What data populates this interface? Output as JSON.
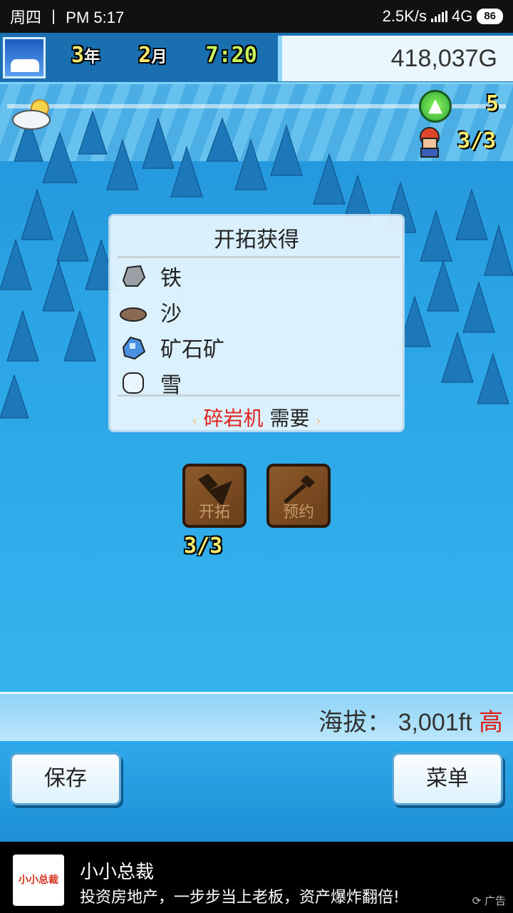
{
  "status_bar": {
    "day": "周四",
    "separator": "丨",
    "ampm": "PM",
    "time": "5:17",
    "net_speed": "2.5K/s",
    "network": "4G",
    "battery": "86"
  },
  "hud": {
    "year": "3",
    "year_unit": "年",
    "month": "2",
    "month_unit": "月",
    "clock": "7:20",
    "money": "418,037G",
    "exp_count": "5",
    "workers": "3/3"
  },
  "popup": {
    "title": "开拓获得",
    "items": [
      {
        "icon": "iron-ore-icon",
        "label": "铁"
      },
      {
        "icon": "sand-icon",
        "label": "沙"
      },
      {
        "icon": "ore-deposit-icon",
        "label": "矿石矿"
      },
      {
        "icon": "snow-icon",
        "label": "雪"
      }
    ],
    "required_tool": "碎岩机",
    "required_suffix": "需要",
    "arrow_left": "‹",
    "arrow_right": "›"
  },
  "actions": {
    "develop_label": "开拓",
    "reserve_label": "预约",
    "develop_count": "3/3"
  },
  "bottom": {
    "altitude_label": "海拔：",
    "altitude_value": "3,001ft",
    "altitude_level": "高",
    "save_label": "保存",
    "menu_label": "菜单"
  },
  "ad": {
    "logo_text": "小小总裁",
    "title": "小小总裁",
    "description": "投资房地产，一步步当上老板，资产爆炸翻倍!",
    "tag": "广告"
  }
}
